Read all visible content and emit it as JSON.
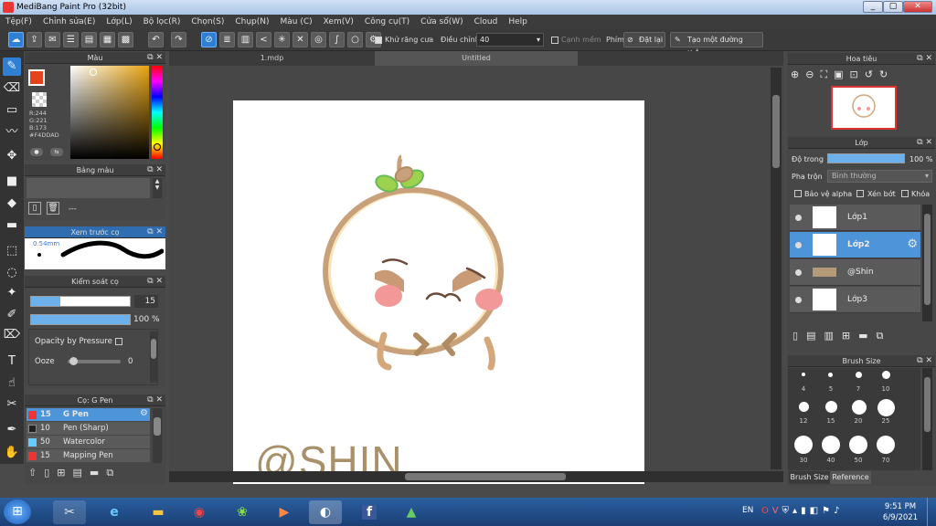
{
  "window": {
    "title": "MediBang Paint Pro (32bit)",
    "min": "_",
    "max": "▢",
    "close": "✕"
  },
  "menu": [
    "Tệp(F)",
    "Chỉnh sửa(E)",
    "Lớp(L)",
    "Bộ lọc(R)",
    "Chọn(S)",
    "Chụp(N)",
    "Màu (C)",
    "Xem(V)",
    "Công cụ(T)",
    "Cửa sổ(W)",
    "Cloud",
    "Help"
  ],
  "toolbar": {
    "antialias_label": "Khử răng cưa",
    "adjust_label": "Điều chỉnh",
    "adjust_value": "40",
    "edge_label": "Cạnh mềm",
    "key_label": "Phím",
    "reset_label": "Đặt lại",
    "ruler_label": "Tạo một đường thẳng"
  },
  "color_panel": {
    "title": "Màu",
    "r": "R:244",
    "g": "G:221",
    "b": "B:173",
    "hex": "#F4DDAD",
    "fg": "#f4ddad"
  },
  "palette_panel": {
    "title": "Bảng màu",
    "dash": "---"
  },
  "brush_preview": {
    "title": "Xem trước cọ",
    "size": "0.54mm"
  },
  "brush_control": {
    "title": "Kiểm soát cọ",
    "size_value": "15",
    "opacity_value": "100 %",
    "opacity_pressure": "Opacity by Pressure",
    "ooze_label": "Ooze",
    "ooze_value": "0"
  },
  "brush_list": {
    "title": "Cọ: G Pen",
    "items": [
      {
        "size": "15",
        "name": "G Pen",
        "color": "#e33"
      },
      {
        "size": "10",
        "name": "Pen (Sharp)",
        "color": "#222"
      },
      {
        "size": "50",
        "name": "Watercolor",
        "color": "#6cf"
      },
      {
        "size": "15",
        "name": "Mapping Pen",
        "color": "#e33"
      }
    ]
  },
  "doc_tabs": [
    "1.mdp",
    "Untitled"
  ],
  "canvas": {
    "watermark": "@SHIN"
  },
  "navigator": {
    "title": "Hoa tiêu"
  },
  "layer_panel": {
    "title": "Lớp",
    "opacity_label": "Độ trong",
    "opacity_value": "100 %",
    "blend_label": "Pha trộn",
    "blend_value": "Bình thường",
    "protect_alpha": "Bảo vệ alpha",
    "clipping": "Xén bớt",
    "lock": "Khóa",
    "layers": [
      "Lớp1",
      "Lớp2",
      "@Shin",
      "Lớp3"
    ]
  },
  "brush_size": {
    "title": "Brush Size",
    "row1": [
      "4",
      "5",
      "7",
      "10"
    ],
    "row2": [
      "12",
      "15",
      "20",
      "25"
    ],
    "row3": [
      "30",
      "40",
      "50",
      "70"
    ],
    "tabs": [
      "Brush Size",
      "Reference"
    ]
  },
  "taskbar": {
    "lang": "EN",
    "time": "9:51 PM",
    "date": "6/9/2021"
  }
}
